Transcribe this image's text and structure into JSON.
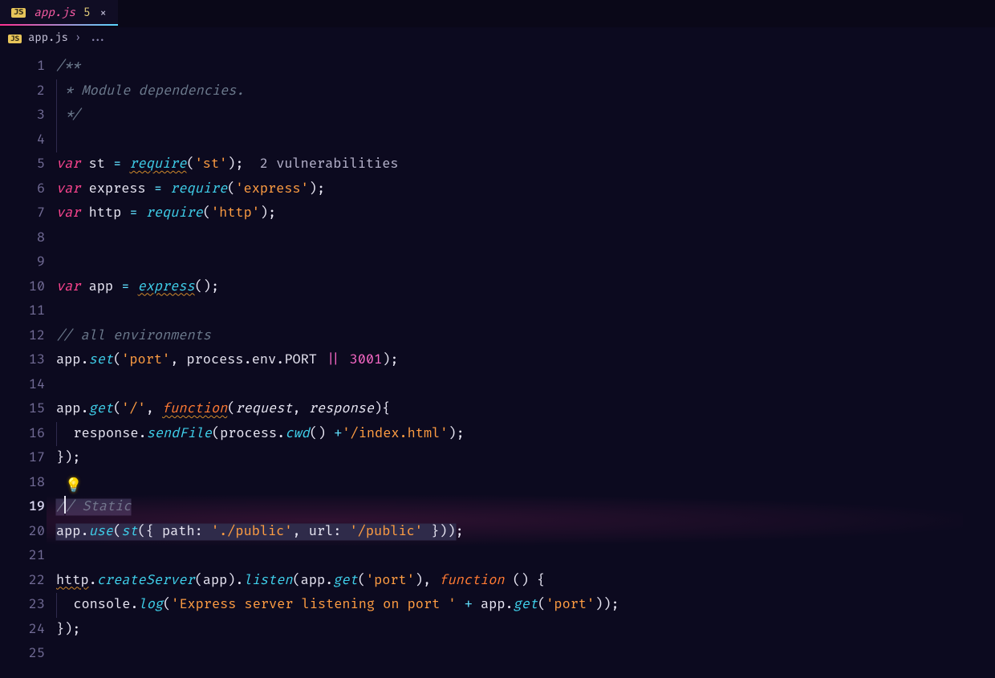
{
  "tab": {
    "badge": "JS",
    "name": "app.js",
    "problems": "5"
  },
  "breadcrumb": {
    "badge": "JS",
    "file": "app.js",
    "rest": "..."
  },
  "code": {
    "active_line": 19,
    "lines": [
      {
        "n": 1,
        "t": "/**",
        "kind": "doc-open"
      },
      {
        "n": 2,
        "t": "Module dependencies.",
        "kind": "doc-body"
      },
      {
        "n": 3,
        "t": "*/",
        "kind": "doc-close"
      },
      {
        "n": 4,
        "t": "",
        "kind": "blank-guided"
      },
      {
        "n": 5,
        "kind": "require",
        "name": "st",
        "mod": "st",
        "annot": "2 vulnerabilities"
      },
      {
        "n": 6,
        "kind": "require",
        "name": "express",
        "mod": "express"
      },
      {
        "n": 7,
        "kind": "require",
        "name": "http",
        "mod": "http"
      },
      {
        "n": 8,
        "t": "",
        "kind": "blank"
      },
      {
        "n": 9,
        "t": "",
        "kind": "blank"
      },
      {
        "n": 10,
        "kind": "appinit"
      },
      {
        "n": 11,
        "t": "",
        "kind": "blank"
      },
      {
        "n": 12,
        "t": "// all environments",
        "kind": "comment"
      },
      {
        "n": 13,
        "kind": "appset",
        "key": "port",
        "envvar": "PORT",
        "fallback": "3001"
      },
      {
        "n": 14,
        "t": "",
        "kind": "blank"
      },
      {
        "n": 15,
        "kind": "appget-open",
        "route": "/",
        "param1": "request",
        "param2": "response"
      },
      {
        "n": 16,
        "kind": "sendfile",
        "path": "/index.html"
      },
      {
        "n": 17,
        "kind": "close-brace-paren"
      },
      {
        "n": 18,
        "kind": "bulb"
      },
      {
        "n": 19,
        "t": "// Static",
        "kind": "comment-selected"
      },
      {
        "n": 20,
        "kind": "appuse-st",
        "path": "./public",
        "url": "/public"
      },
      {
        "n": 21,
        "t": "",
        "kind": "blank"
      },
      {
        "n": 22,
        "kind": "server-open",
        "key": "port"
      },
      {
        "n": 23,
        "kind": "consolelog",
        "msg": "Express server listening on port ",
        "key": "port"
      },
      {
        "n": 24,
        "kind": "close-brace-paren"
      },
      {
        "n": 25,
        "t": "",
        "kind": "blank"
      }
    ]
  },
  "tokens": {
    "var": "var",
    "require": "require",
    "function": "function",
    "express": "express",
    "console": "console",
    "log": "log"
  }
}
